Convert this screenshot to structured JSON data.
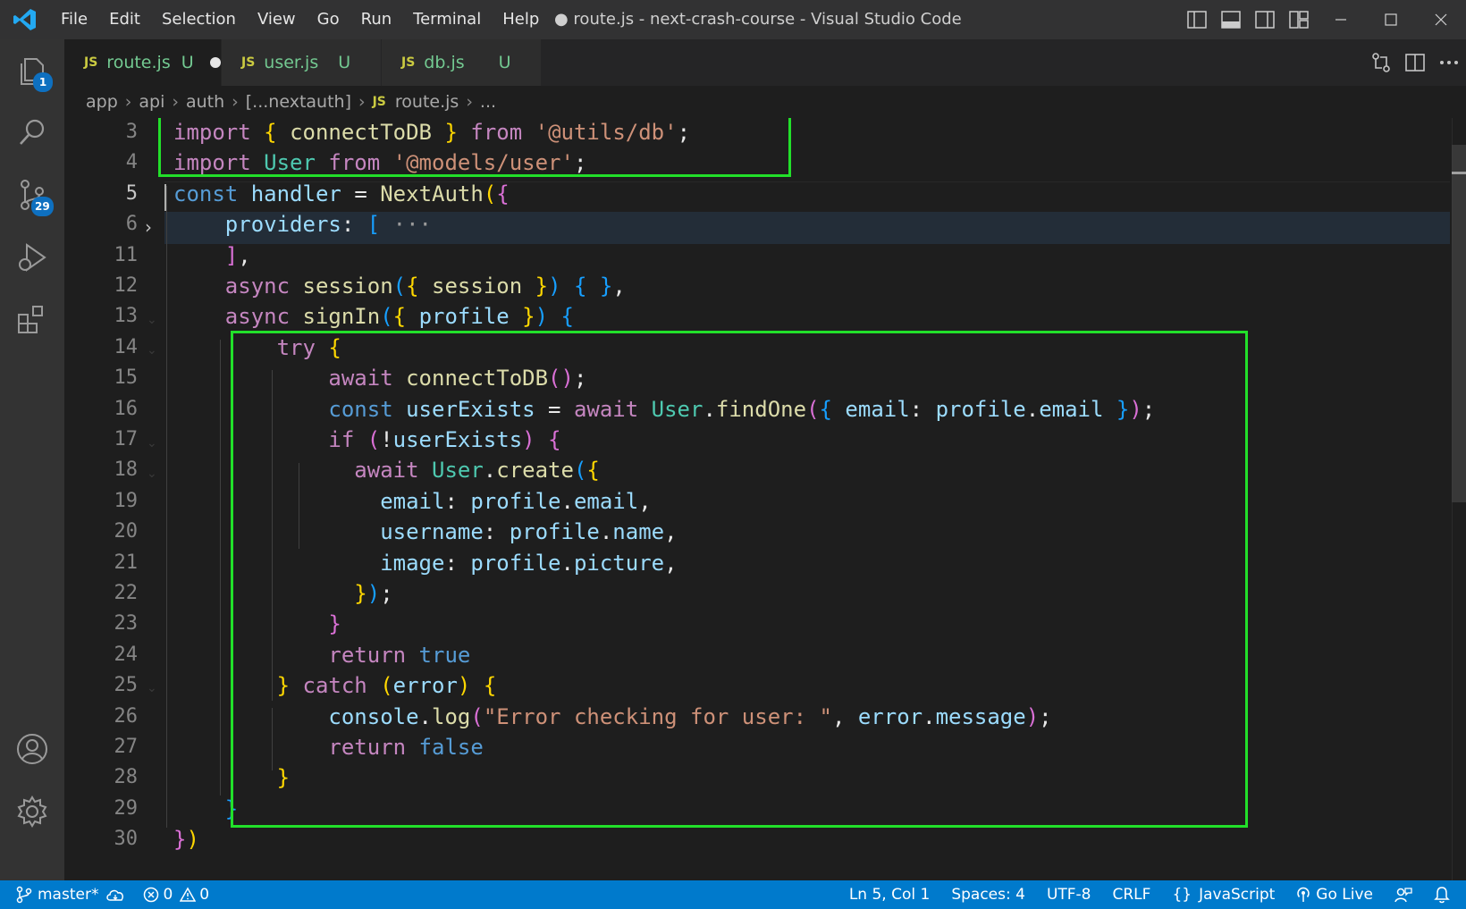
{
  "window": {
    "title": "● route.js - next-crash-course - Visual Studio Code"
  },
  "menu": [
    "File",
    "Edit",
    "Selection",
    "View",
    "Go",
    "Run",
    "Terminal",
    "Help"
  ],
  "activity_bar": {
    "explorer_badge": "1",
    "source_control_badge": "29"
  },
  "tabs": [
    {
      "icon": "JS",
      "name": "route.js",
      "status": "U",
      "dirty": true
    },
    {
      "icon": "JS",
      "name": "user.js",
      "status": "U",
      "dirty": false
    },
    {
      "icon": "JS",
      "name": "db.js",
      "status": "U",
      "dirty": false
    }
  ],
  "breadcrumb": {
    "parts": [
      "app",
      "api",
      "auth",
      "[...nextauth]"
    ],
    "file_icon": "JS",
    "file": "route.js",
    "tail": "..."
  },
  "editor": {
    "lines": [
      {
        "n": "3",
        "text": "import { connectToDB } from '@utils/db';"
      },
      {
        "n": "4",
        "text": "import User from '@models/user';"
      },
      {
        "n": "5",
        "text": "const handler = NextAuth({"
      },
      {
        "n": "6",
        "text": "    providers: [ ···"
      },
      {
        "n": "11",
        "text": "    ],"
      },
      {
        "n": "12",
        "text": "    async session({ session }) { },"
      },
      {
        "n": "13",
        "text": "    async signIn({ profile }) {"
      },
      {
        "n": "14",
        "text": "        try {"
      },
      {
        "n": "15",
        "text": "            await connectToDB();"
      },
      {
        "n": "16",
        "text": "            const userExists = await User.findOne({ email: profile.email });"
      },
      {
        "n": "17",
        "text": "            if (!userExists) {"
      },
      {
        "n": "18",
        "text": "              await User.create({"
      },
      {
        "n": "19",
        "text": "                email: profile.email,"
      },
      {
        "n": "20",
        "text": "                username: profile.name,"
      },
      {
        "n": "21",
        "text": "                image: profile.picture,"
      },
      {
        "n": "22",
        "text": "              });"
      },
      {
        "n": "23",
        "text": "            }"
      },
      {
        "n": "24",
        "text": "            return true"
      },
      {
        "n": "25",
        "text": "        } catch (error) {"
      },
      {
        "n": "26",
        "text": "            console.log(\"Error checking for user: \", error.message);"
      },
      {
        "n": "27",
        "text": "            return false"
      },
      {
        "n": "28",
        "text": "        }"
      },
      {
        "n": "29",
        "text": "    }"
      },
      {
        "n": "30",
        "text": "})"
      }
    ]
  },
  "status_bar": {
    "branch": "master*",
    "errors": "0",
    "warnings": "0",
    "position": "Ln 5, Col 1",
    "spaces": "Spaces: 4",
    "encoding": "UTF-8",
    "eol": "CRLF",
    "language": "JavaScript",
    "go_live": "Go Live"
  },
  "colors": {
    "highlight_box": "#22e02a",
    "status_bar": "#007acc"
  }
}
